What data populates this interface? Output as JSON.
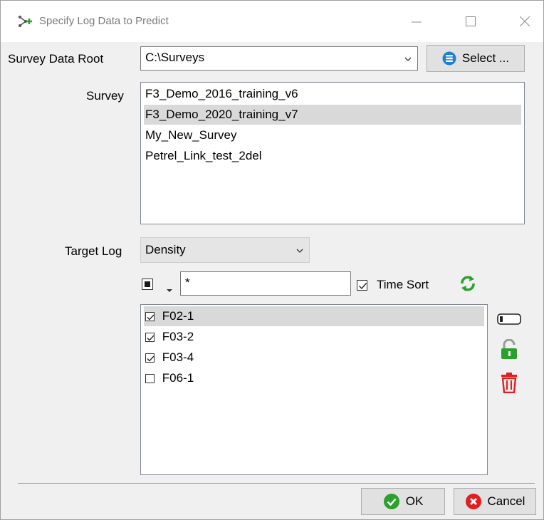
{
  "window": {
    "title": "Specify Log Data to Predict"
  },
  "survey_data_root": {
    "label": "Survey Data Root",
    "value": "C:\\Surveys",
    "select_label": "Select ..."
  },
  "survey": {
    "label": "Survey",
    "items": [
      "F3_Demo_2016_training_v6",
      "F3_Demo_2020_training_v7",
      "My_New_Survey",
      "Petrel_Link_test_2del"
    ],
    "selected_index": 1
  },
  "target_log": {
    "label": "Target Log",
    "value": "Density"
  },
  "filter": {
    "value": "*",
    "time_sort_label": "Time Sort",
    "time_sort_checked": true
  },
  "wells": {
    "items": [
      {
        "label": "F02-1",
        "checked": true
      },
      {
        "label": "F03-2",
        "checked": true
      },
      {
        "label": "F03-4",
        "checked": true
      },
      {
        "label": "F06-1",
        "checked": false
      }
    ],
    "selected_index": 0
  },
  "buttons": {
    "ok": "OK",
    "cancel": "Cancel"
  },
  "colors": {
    "accent_blue": "#1e7fd8",
    "green": "#2ca02c",
    "red": "#e02020",
    "selection": "#d9d9d9"
  }
}
